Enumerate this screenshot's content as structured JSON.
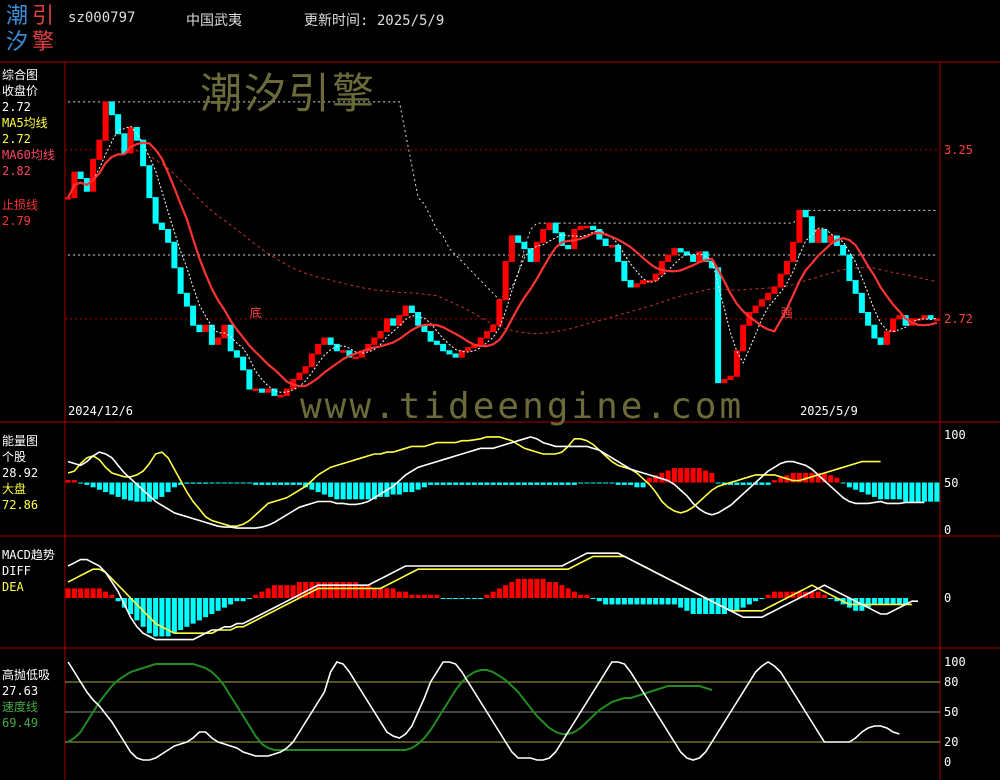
{
  "header": {
    "logo_chars": [
      "潮",
      "引",
      "汐",
      "擎"
    ],
    "code": "sz000797",
    "name": "中国武夷",
    "update_label": "更新时间: 2025/5/9"
  },
  "watermarks": {
    "top": "潮汐引擎",
    "mid": "www.tideengine.com"
  },
  "colors": {
    "up": "#ff0000",
    "down": "#00ffff",
    "ma5": "#ffffff",
    "ma60": "#ff3333",
    "yellow": "#ffff44",
    "green": "#228b22",
    "grid": "#aa0000"
  },
  "panels": {
    "main": {
      "title": "综合图",
      "legend": [
        {
          "name": "收盘价",
          "value": "2.72",
          "color": "#ffffff"
        },
        {
          "name": "MA5均线",
          "value": "2.72",
          "color": "#ffff44"
        },
        {
          "name": "MA60均线",
          "value": "2.82",
          "color": "#ff4466"
        },
        {
          "name": "止损线",
          "value": "2.79",
          "color": "#ff3333"
        }
      ],
      "y_ticks": [
        "3.25",
        "2.72"
      ],
      "date_start": "2024/12/6",
      "date_end": "2025/5/9",
      "annotations": [
        {
          "text": "底",
          "x": 30
        },
        {
          "text": "强",
          "x": 115
        }
      ]
    },
    "energy": {
      "title": "能量图",
      "legend": [
        {
          "name": "个股",
          "value": "28.92",
          "color": "#ffffff"
        },
        {
          "name": "大盘",
          "value": "72.86",
          "color": "#ffff44"
        }
      ],
      "y_ticks": [
        "100",
        "50",
        "0"
      ]
    },
    "macd": {
      "title": "MACD趋势",
      "legend": [
        {
          "name": "DIFF",
          "value": "",
          "color": "#ffffff"
        },
        {
          "name": "DEA",
          "value": "",
          "color": "#ffff44"
        }
      ],
      "y_ticks": [
        "0"
      ]
    },
    "gdx": {
      "title": "高抛低吸",
      "legend": [
        {
          "name": "",
          "value": "27.63",
          "color": "#ffffff"
        },
        {
          "name": "速度线",
          "value": "",
          "color": "#44aa44"
        },
        {
          "name": "",
          "value": "69.49",
          "color": "#44aa44"
        }
      ],
      "y_ticks": [
        "100",
        "80",
        "50",
        "20",
        "0"
      ]
    }
  },
  "chart_data": {
    "type": "candlestick",
    "n": 140,
    "ylim": [
      2.45,
      3.5
    ],
    "closes": [
      3.1,
      3.18,
      3.16,
      3.12,
      3.22,
      3.28,
      3.4,
      3.36,
      3.3,
      3.24,
      3.32,
      3.28,
      3.2,
      3.1,
      3.02,
      3.0,
      2.96,
      2.88,
      2.8,
      2.76,
      2.7,
      2.68,
      2.7,
      2.64,
      2.66,
      2.7,
      2.62,
      2.6,
      2.56,
      2.5,
      2.5,
      2.49,
      2.5,
      2.48,
      2.48,
      2.5,
      2.53,
      2.55,
      2.57,
      2.61,
      2.64,
      2.66,
      2.64,
      2.62,
      2.62,
      2.6,
      2.6,
      2.62,
      2.64,
      2.66,
      2.68,
      2.72,
      2.7,
      2.73,
      2.76,
      2.74,
      2.7,
      2.68,
      2.65,
      2.64,
      2.62,
      2.61,
      2.6,
      2.62,
      2.63,
      2.64,
      2.66,
      2.68,
      2.7,
      2.78,
      2.9,
      2.98,
      2.96,
      2.94,
      2.9,
      2.96,
      3.0,
      3.02,
      2.99,
      2.95,
      2.94,
      3.0,
      3.01,
      3.01,
      3.0,
      2.97,
      2.95,
      2.95,
      2.9,
      2.84,
      2.82,
      2.83,
      2.84,
      2.84,
      2.86,
      2.9,
      2.92,
      2.94,
      2.93,
      2.92,
      2.9,
      2.93,
      2.9,
      2.88,
      2.52,
      2.53,
      2.54,
      2.62,
      2.7,
      2.74,
      2.76,
      2.78,
      2.8,
      2.82,
      2.86,
      2.9,
      2.96,
      3.06,
      3.04,
      2.96,
      3.0,
      2.96,
      2.98,
      2.95,
      2.92,
      2.84,
      2.8,
      2.74,
      2.7,
      2.66,
      2.64,
      2.68,
      2.72,
      2.73,
      2.7,
      2.72,
      2.72,
      2.73,
      2.72,
      2.72
    ],
    "stop_line_upper": [
      3.4,
      3.4,
      3.4,
      3.4,
      3.4,
      3.4,
      3.4,
      3.4,
      3.4,
      3.4,
      3.4,
      3.4,
      3.4,
      3.4,
      3.4,
      3.4,
      3.4,
      3.4,
      3.4,
      3.4,
      3.4,
      3.4,
      3.4,
      3.4,
      3.4,
      3.4,
      3.4,
      3.4,
      3.4,
      3.4,
      3.4,
      3.4,
      3.4,
      3.4,
      3.4,
      3.4,
      3.4,
      3.4,
      3.4,
      3.4,
      3.4,
      3.4,
      3.4,
      3.4,
      3.4,
      3.4,
      3.4,
      3.4,
      3.4,
      3.4,
      3.4,
      3.4,
      3.4,
      3.4,
      3.3,
      3.2,
      3.1,
      3.08,
      3.04,
      3.0,
      2.98,
      2.94,
      2.92,
      2.9,
      2.88,
      2.86,
      2.84,
      2.82,
      2.8,
      2.78,
      2.8,
      2.82,
      2.86,
      2.94,
      3.0,
      3.02,
      3.02,
      3.02,
      3.02,
      3.02,
      3.02,
      3.02,
      3.02,
      3.02,
      3.02,
      3.02,
      3.02,
      3.02,
      3.02,
      3.02,
      3.02,
      3.02,
      3.02,
      3.02,
      3.02,
      3.02,
      3.02,
      3.02,
      3.02,
      3.02,
      3.02,
      3.02,
      3.02,
      3.02,
      3.02,
      3.02,
      3.02,
      3.02,
      3.02,
      3.02,
      3.02,
      3.02,
      3.02,
      3.02,
      3.02,
      3.02,
      3.02,
      3.04,
      3.06,
      3.06,
      3.06,
      3.06,
      3.06,
      3.06,
      3.06,
      3.06,
      3.06,
      3.06,
      3.06,
      3.06,
      3.06,
      3.06,
      3.06,
      3.06,
      3.06,
      3.06,
      3.06,
      3.06,
      3.06,
      3.06
    ],
    "stop_line_lower": [
      2.92,
      2.92,
      2.92,
      2.92,
      2.92,
      2.92,
      2.92,
      2.92,
      2.92,
      2.92,
      2.92,
      2.92,
      2.92,
      2.92,
      2.92,
      2.92,
      2.92,
      2.92,
      2.92,
      2.92,
      2.92,
      2.92,
      2.92,
      2.92,
      2.92,
      2.92,
      2.92,
      2.92,
      2.92,
      2.92,
      2.92,
      2.92,
      2.92,
      2.92,
      2.92,
      2.92,
      2.92,
      2.92,
      2.92,
      2.92,
      2.92,
      2.92,
      2.92,
      2.92,
      2.92,
      2.92,
      2.92,
      2.92,
      2.92,
      2.92,
      2.92,
      2.92,
      2.92,
      2.92,
      2.92,
      2.92,
      2.92,
      2.92,
      2.92,
      2.92,
      2.92,
      2.92,
      2.92,
      2.92,
      2.92,
      2.92,
      2.92,
      2.92,
      2.92,
      2.92,
      2.92,
      2.92,
      2.92,
      2.92,
      2.92,
      2.92,
      2.92,
      2.92,
      2.92,
      2.92,
      2.92,
      2.92,
      2.92,
      2.92,
      2.92,
      2.92,
      2.92,
      2.92,
      2.92,
      2.92,
      2.92,
      2.92,
      2.92,
      2.92,
      2.92,
      2.92,
      2.92,
      2.92,
      2.92,
      2.92,
      2.92,
      2.92,
      2.92,
      2.92,
      2.92,
      2.92,
      2.92,
      2.92,
      2.92,
      2.92,
      2.92,
      2.92,
      2.92,
      2.92,
      2.92,
      2.92,
      2.92,
      2.92,
      2.92,
      2.92,
      2.92,
      2.92,
      2.92,
      2.92,
      2.92,
      2.92,
      2.92,
      2.92,
      2.92,
      2.92,
      2.92,
      2.92,
      2.92,
      2.92,
      2.92,
      2.92,
      2.92,
      2.92,
      2.92,
      2.92
    ],
    "energy_stock": [
      72,
      70,
      68,
      72,
      78,
      82,
      80,
      76,
      68,
      60,
      54,
      48,
      42,
      36,
      30,
      26,
      22,
      18,
      16,
      14,
      12,
      10,
      8,
      6,
      4,
      3,
      3,
      2,
      2,
      2,
      2,
      3,
      5,
      8,
      12,
      16,
      20,
      24,
      26,
      28,
      30,
      30,
      30,
      28,
      28,
      27,
      27,
      28,
      30,
      34,
      38,
      42,
      46,
      52,
      58,
      62,
      66,
      68,
      70,
      72,
      74,
      76,
      78,
      80,
      82,
      84,
      86,
      86,
      86,
      88,
      90,
      92,
      94,
      96,
      98,
      96,
      92,
      90,
      88,
      88,
      88,
      88,
      88,
      88,
      86,
      84,
      80,
      76,
      72,
      68,
      64,
      62,
      60,
      58,
      56,
      54,
      52,
      48,
      42,
      36,
      28,
      22,
      18,
      16,
      18,
      22,
      26,
      32,
      38,
      44,
      50,
      56,
      62,
      66,
      70,
      72,
      72,
      70,
      68,
      64,
      58,
      52,
      46,
      40,
      34,
      30,
      28,
      28,
      28,
      29,
      30,
      28,
      28,
      28,
      29,
      29,
      29,
      29
    ],
    "energy_market": [
      60,
      62,
      70,
      76,
      78,
      74,
      66,
      60,
      58,
      56,
      56,
      58,
      62,
      70,
      80,
      82,
      76,
      64,
      52,
      40,
      30,
      22,
      14,
      10,
      8,
      6,
      4,
      4,
      6,
      10,
      16,
      22,
      28,
      30,
      32,
      34,
      38,
      42,
      46,
      52,
      58,
      62,
      66,
      68,
      70,
      72,
      74,
      76,
      78,
      80,
      80,
      82,
      82,
      84,
      86,
      88,
      88,
      88,
      90,
      92,
      92,
      92,
      92,
      94,
      94,
      95,
      96,
      98,
      98,
      98,
      96,
      94,
      90,
      86,
      84,
      82,
      80,
      80,
      80,
      82,
      88,
      96,
      96,
      94,
      90,
      84,
      78,
      72,
      68,
      66,
      64,
      60,
      54,
      48,
      40,
      30,
      24,
      20,
      18,
      20,
      24,
      30,
      36,
      42,
      46,
      48,
      50,
      52,
      54,
      56,
      58,
      58,
      58,
      58,
      56,
      54,
      52,
      52,
      54,
      56,
      58,
      60,
      62,
      64,
      66,
      68,
      70,
      72,
      72,
      72,
      72
    ],
    "energy_bars": [
      2,
      2,
      0,
      -2,
      -4,
      -6,
      -8,
      -10,
      -12,
      -14,
      -15,
      -16,
      -16,
      -16,
      -14,
      -12,
      -8,
      -4,
      -2,
      -1,
      -1,
      -1,
      -1,
      0,
      0,
      0,
      0,
      0,
      0,
      0,
      -2,
      -2,
      -2,
      -2,
      -2,
      -2,
      -2,
      -2,
      -4,
      -6,
      -8,
      -10,
      -12,
      -14,
      -14,
      -14,
      -14,
      -14,
      -14,
      -14,
      -12,
      -12,
      -10,
      -10,
      -8,
      -8,
      -6,
      -4,
      -2,
      -2,
      -2,
      -2,
      -2,
      -2,
      -2,
      -2,
      -2,
      -2,
      -2,
      -2,
      -2,
      -2,
      -2,
      -2,
      -2,
      -2,
      -2,
      -2,
      -2,
      -2,
      -2,
      -2,
      0,
      0,
      0,
      0,
      0,
      0,
      -2,
      -2,
      -2,
      -4,
      -4,
      4,
      6,
      8,
      10,
      12,
      12,
      12,
      12,
      12,
      10,
      8,
      0,
      -2,
      -2,
      -2,
      -2,
      -2,
      -2,
      -2,
      -2,
      2,
      4,
      6,
      8,
      8,
      8,
      8,
      8,
      8,
      6,
      4,
      0,
      -4,
      -6,
      -8,
      -10,
      -12,
      -14,
      -14,
      -14,
      -14,
      -16,
      -16,
      -16,
      -16,
      -16,
      -16
    ],
    "macd_diff": [
      20,
      22,
      24,
      24,
      22,
      20,
      16,
      10,
      4,
      -4,
      -12,
      -18,
      -22,
      -24,
      -26,
      -26,
      -26,
      -26,
      -26,
      -26,
      -26,
      -24,
      -22,
      -20,
      -20,
      -18,
      -18,
      -16,
      -16,
      -14,
      -12,
      -10,
      -8,
      -6,
      -4,
      -2,
      0,
      2,
      4,
      6,
      8,
      8,
      8,
      8,
      8,
      8,
      8,
      8,
      8,
      10,
      12,
      14,
      16,
      18,
      20,
      20,
      20,
      20,
      20,
      20,
      20,
      20,
      20,
      20,
      20,
      20,
      20,
      20,
      20,
      20,
      20,
      20,
      20,
      20,
      20,
      20,
      20,
      20,
      20,
      20,
      22,
      24,
      26,
      28,
      28,
      28,
      28,
      28,
      28,
      26,
      24,
      22,
      20,
      18,
      16,
      14,
      12,
      10,
      8,
      6,
      4,
      2,
      0,
      -2,
      -4,
      -6,
      -8,
      -10,
      -12,
      -12,
      -12,
      -12,
      -10,
      -8,
      -6,
      -4,
      -2,
      0,
      2,
      4,
      6,
      8,
      6,
      4,
      2,
      0,
      -2,
      -4,
      -6,
      -8,
      -10,
      -10,
      -8,
      -6,
      -4,
      -2,
      -2
    ],
    "macd_dea": [
      10,
      12,
      14,
      16,
      18,
      18,
      16,
      12,
      8,
      4,
      0,
      -4,
      -8,
      -12,
      -16,
      -18,
      -20,
      -22,
      -22,
      -22,
      -22,
      -22,
      -22,
      -22,
      -20,
      -20,
      -20,
      -18,
      -18,
      -16,
      -14,
      -12,
      -10,
      -8,
      -6,
      -4,
      -2,
      0,
      2,
      4,
      6,
      6,
      6,
      6,
      6,
      6,
      6,
      6,
      6,
      6,
      6,
      8,
      10,
      12,
      14,
      16,
      18,
      18,
      18,
      18,
      18,
      18,
      18,
      18,
      18,
      18,
      18,
      18,
      18,
      18,
      18,
      18,
      18,
      18,
      18,
      18,
      18,
      18,
      18,
      18,
      18,
      20,
      22,
      24,
      26,
      26,
      26,
      26,
      26,
      26,
      24,
      22,
      20,
      18,
      16,
      14,
      12,
      10,
      8,
      6,
      4,
      2,
      0,
      -2,
      -4,
      -6,
      -8,
      -8,
      -8,
      -8,
      -8,
      -8,
      -6,
      -4,
      -2,
      0,
      2,
      4,
      6,
      8,
      6,
      4,
      2,
      0,
      -2,
      -4,
      -4,
      -4,
      -4,
      -4,
      -4,
      -4,
      -4,
      -4,
      -4,
      -4
    ],
    "macd_bars": [
      6,
      6,
      6,
      6,
      6,
      6,
      4,
      2,
      -2,
      -6,
      -10,
      -14,
      -18,
      -22,
      -24,
      -24,
      -24,
      -22,
      -20,
      -18,
      -16,
      -14,
      -12,
      -10,
      -8,
      -6,
      -4,
      -2,
      -2,
      0,
      2,
      4,
      6,
      8,
      8,
      8,
      8,
      10,
      10,
      10,
      10,
      10,
      10,
      10,
      10,
      10,
      10,
      8,
      8,
      6,
      6,
      6,
      6,
      4,
      4,
      2,
      2,
      2,
      2,
      2,
      0,
      0,
      0,
      0,
      0,
      0,
      0,
      2,
      4,
      6,
      8,
      10,
      12,
      12,
      12,
      12,
      12,
      10,
      10,
      8,
      6,
      4,
      2,
      2,
      0,
      -2,
      -4,
      -4,
      -4,
      -4,
      -4,
      -4,
      -4,
      -4,
      -4,
      -4,
      -4,
      -4,
      -6,
      -8,
      -10,
      -10,
      -10,
      -10,
      -10,
      -10,
      -8,
      -8,
      -6,
      -4,
      -2,
      0,
      2,
      4,
      4,
      4,
      4,
      4,
      4,
      4,
      4,
      2,
      0,
      -2,
      -4,
      -6,
      -8,
      -8,
      -6,
      -4,
      -4,
      -4,
      -4,
      -4,
      -4
    ],
    "gdx_white": [
      100,
      90,
      80,
      70,
      62,
      56,
      48,
      40,
      30,
      20,
      10,
      4,
      2,
      2,
      4,
      8,
      12,
      16,
      18,
      20,
      24,
      30,
      30,
      24,
      20,
      18,
      16,
      14,
      10,
      8,
      6,
      6,
      6,
      8,
      10,
      14,
      20,
      30,
      40,
      50,
      60,
      70,
      90,
      100,
      98,
      90,
      80,
      70,
      60,
      50,
      40,
      30,
      26,
      24,
      28,
      36,
      50,
      64,
      80,
      90,
      100,
      100,
      98,
      90,
      80,
      70,
      60,
      50,
      40,
      30,
      20,
      10,
      4,
      4,
      4,
      2,
      2,
      4,
      10,
      20,
      30,
      40,
      50,
      60,
      70,
      80,
      90,
      100,
      100,
      98,
      90,
      80,
      70,
      60,
      50,
      40,
      30,
      20,
      10,
      4,
      2,
      4,
      10,
      20,
      30,
      40,
      50,
      60,
      70,
      80,
      90,
      96,
      100,
      96,
      90,
      80,
      70,
      60,
      50,
      40,
      30,
      20,
      20,
      20,
      20,
      20,
      24,
      30,
      34,
      36,
      36,
      34,
      30,
      28
    ],
    "gdx_speed": [
      20,
      24,
      30,
      40,
      50,
      60,
      68,
      76,
      82,
      86,
      90,
      92,
      94,
      96,
      98,
      98,
      98,
      98,
      98,
      98,
      98,
      96,
      94,
      90,
      84,
      76,
      66,
      56,
      46,
      36,
      26,
      18,
      14,
      12,
      12,
      12,
      12,
      12,
      12,
      12,
      12,
      12,
      12,
      12,
      12,
      12,
      12,
      12,
      12,
      12,
      12,
      12,
      12,
      12,
      12,
      14,
      18,
      24,
      32,
      42,
      52,
      62,
      72,
      80,
      86,
      90,
      92,
      92,
      90,
      86,
      82,
      76,
      70,
      62,
      54,
      46,
      40,
      34,
      30,
      28,
      28,
      30,
      34,
      40,
      46,
      52,
      56,
      60,
      62,
      64,
      64,
      66,
      68,
      70,
      72,
      74,
      76,
      76,
      76,
      76,
      76,
      76,
      74,
      72
    ]
  }
}
